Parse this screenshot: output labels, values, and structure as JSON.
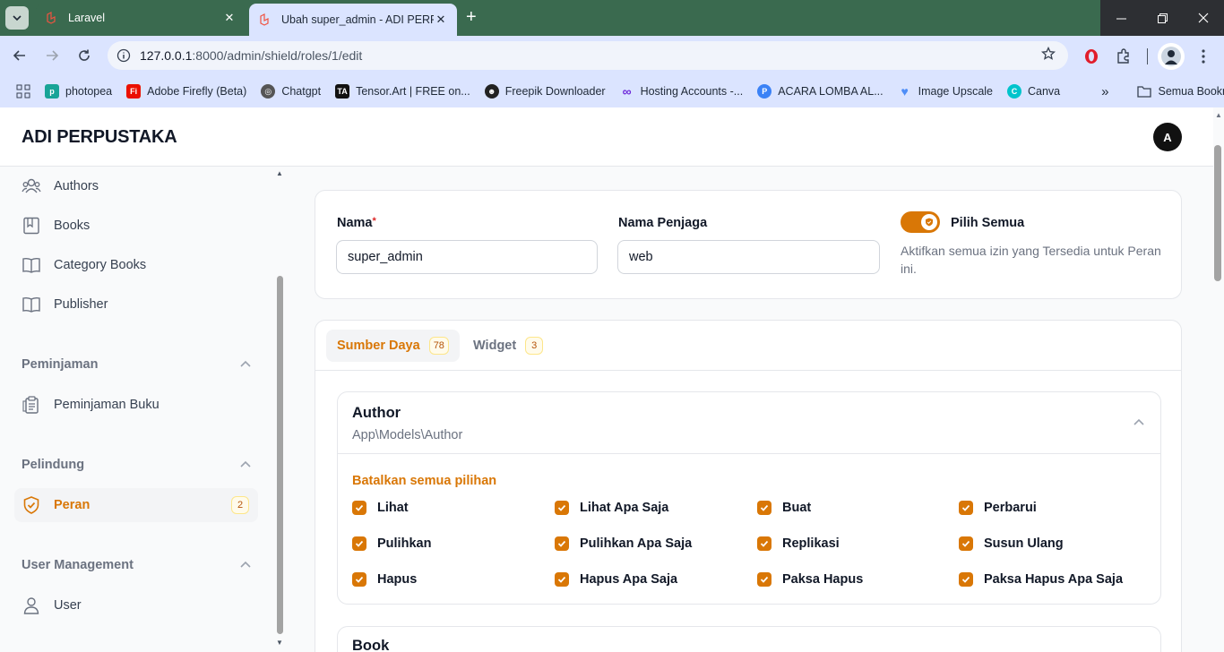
{
  "browser": {
    "tabs": [
      {
        "title": "Laravel",
        "active": false
      },
      {
        "title": "Ubah super_admin - ADI PERPUS",
        "active": true
      }
    ],
    "address": {
      "host": "127.0.0.1",
      "path": ":8000/admin/shield/roles/1/edit"
    },
    "bookmarks": [
      {
        "label": "photopea",
        "color": "#18a497"
      },
      {
        "label": "Adobe Firefly (Beta)",
        "color": "#eb1000"
      },
      {
        "label": "Chatgpt",
        "color": "#555555"
      },
      {
        "label": "Tensor.Art | FREE on...",
        "color": "#111111"
      },
      {
        "label": "Freepik Downloader",
        "color": "#222222"
      },
      {
        "label": "Hosting Accounts -...",
        "color": "#6d28d9"
      },
      {
        "label": "ACARA LOMBA AL...",
        "color": "#3b82f6"
      },
      {
        "label": "Image Upscale",
        "color": "#4f8ef7"
      },
      {
        "label": "Canva",
        "color": "#00c4cc"
      }
    ],
    "all_bookmarks_label": "Semua Bookmark"
  },
  "app": {
    "brand": "ADI PERPUSTAKA",
    "avatar_initial": "A",
    "accent": "#d97706"
  },
  "sidebar": {
    "items_top": [
      {
        "label": "Authors",
        "icon": "users-icon"
      },
      {
        "label": "Books",
        "icon": "book-icon"
      },
      {
        "label": "Category Books",
        "icon": "book-open-icon"
      },
      {
        "label": "Publisher",
        "icon": "book-open-icon"
      }
    ],
    "groups": [
      {
        "label": "Peminjaman",
        "items": [
          {
            "label": "Peminjaman Buku"
          }
        ]
      },
      {
        "label": "Pelindung",
        "items": [
          {
            "label": "Peran",
            "badge": "2",
            "active": true
          }
        ]
      },
      {
        "label": "User Management",
        "items": [
          {
            "label": "User"
          }
        ]
      }
    ]
  },
  "form": {
    "name_label": "Nama",
    "name_required": "*",
    "name_value": "super_admin",
    "guard_label": "Nama Penjaga",
    "guard_value": "web",
    "select_all_label": "Pilih Semua",
    "select_all_help": "Aktifkan semua izin yang Tersedia untuk Peran ini.",
    "select_all_on": true
  },
  "tabs": [
    {
      "label": "Sumber Daya",
      "count": "78",
      "active": true
    },
    {
      "label": "Widget",
      "count": "3",
      "active": false
    }
  ],
  "resources": [
    {
      "title": "Author",
      "model": "App\\Models\\Author",
      "deselect_label": "Batalkan semua pilihan",
      "permissions": [
        [
          "Lihat",
          "Lihat Apa Saja",
          "Buat",
          "Perbarui"
        ],
        [
          "Pulihkan",
          "Pulihkan Apa Saja",
          "Replikasi",
          "Susun Ulang"
        ],
        [
          "Hapus",
          "Hapus Apa Saja",
          "Paksa Hapus",
          "Paksa Hapus Apa Saja"
        ]
      ]
    },
    {
      "title": "Book"
    }
  ]
}
